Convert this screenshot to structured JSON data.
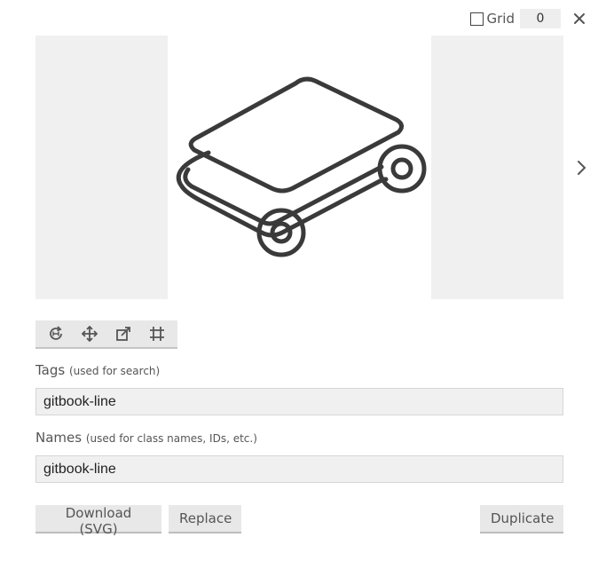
{
  "header": {
    "grid_label": "Grid",
    "grid_checked": false,
    "grid_value": "0"
  },
  "icons": {
    "close": "close-icon",
    "next": "chevron-right-icon",
    "preview": "gitbook-line-icon",
    "tools": [
      "rotate-icon",
      "move-icon",
      "resize-icon",
      "grid-crop-icon"
    ]
  },
  "tags": {
    "label": "Tags",
    "hint": "(used for search)",
    "value": "gitbook-line"
  },
  "names": {
    "label": "Names",
    "hint": "(used for class names, IDs, etc.)",
    "value": "gitbook-line"
  },
  "buttons": {
    "download": "Download (SVG)",
    "replace": "Replace",
    "duplicate": "Duplicate"
  }
}
